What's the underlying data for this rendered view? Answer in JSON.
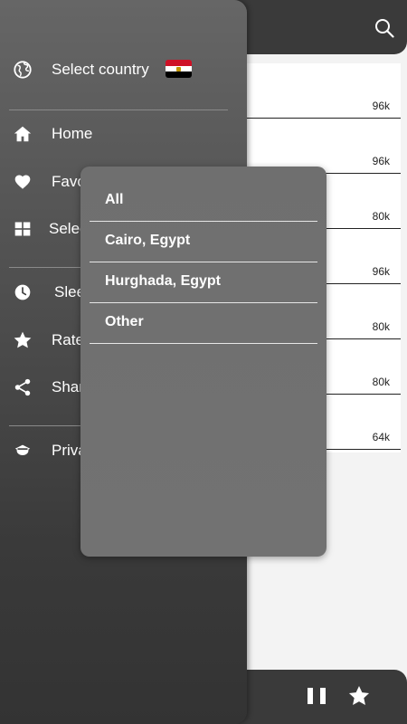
{
  "drawer": {
    "select_country": {
      "label": "Select country",
      "icon": "globe-icon",
      "flag": "egypt-flag"
    },
    "items": [
      {
        "label": "Home",
        "icon": "home-icon"
      },
      {
        "label": "Favo",
        "icon": "heart-icon"
      },
      {
        "label": "Selec",
        "icon": "grid-icon"
      },
      {
        "label": "Slee",
        "icon": "clock-icon"
      },
      {
        "label": "Rate",
        "icon": "star-icon"
      },
      {
        "label": "Shar",
        "icon": "share-icon"
      },
      {
        "label": "Priva",
        "icon": "privacy-icon"
      }
    ]
  },
  "station_list": {
    "bitrates": [
      "96k",
      "96k",
      "80k",
      "96k",
      "80k",
      "80k",
      "64k"
    ]
  },
  "city_popup": {
    "options": [
      "All",
      "Cairo, Egypt",
      "Hurghada, Egypt",
      "Other"
    ]
  },
  "player": {
    "pause_icon": "pause-icon",
    "favorite_icon": "star-icon"
  },
  "colors": {
    "drawer_top": "#666666",
    "drawer_bottom": "#333333",
    "popup_bg": "#707070",
    "bar_bg": "#3a3a3a"
  }
}
